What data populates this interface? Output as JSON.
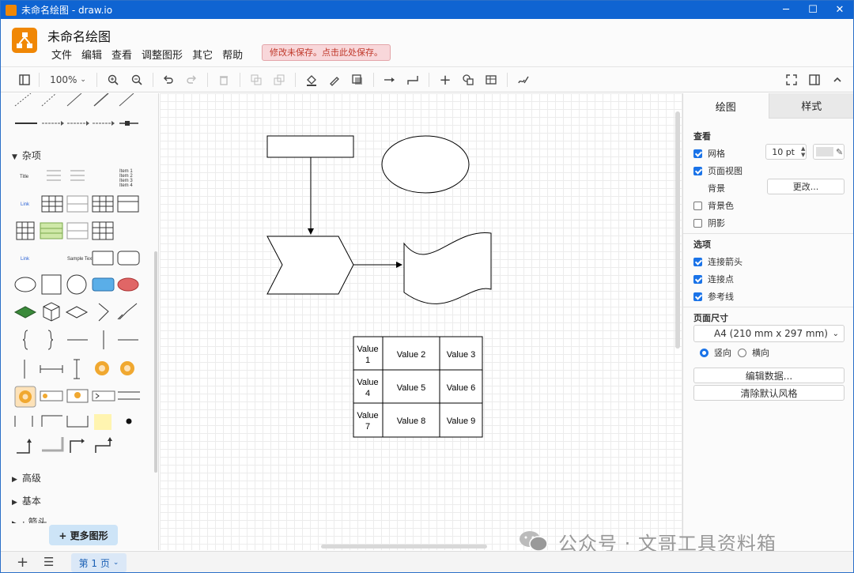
{
  "window": {
    "title": "未命名绘图 - draw.io",
    "controls": [
      "─",
      "☐",
      "✕"
    ]
  },
  "header": {
    "doc_title": "未命名绘图",
    "unsaved_notice": "修改未保存。点击此处保存。"
  },
  "menu": [
    "文件",
    "编辑",
    "查看",
    "调整图形",
    "其它",
    "帮助"
  ],
  "toolbar": {
    "zoom": "100%"
  },
  "sidebar": {
    "section_misc": "杂项",
    "section_advanced": "高级",
    "section_basic": "基本",
    "section_cut": "· 箭头",
    "more_shapes": "+ 更多图形",
    "misc_title": "Title",
    "misc_link": "Link",
    "misc_items": [
      "Item 1",
      "Item 2",
      "Item 3",
      "Item 4"
    ],
    "misc_sample": "Sample Text"
  },
  "canvas": {
    "table": [
      [
        "Value 1",
        "Value 2",
        "Value 3"
      ],
      [
        "Value 4",
        "Value 5",
        "Value 6"
      ],
      [
        "Value 7",
        "Value 8",
        "Value 9"
      ]
    ]
  },
  "panel": {
    "tab_diagram": "绘图",
    "tab_style": "样式",
    "view_heading": "查看",
    "grid_label": "网格",
    "grid_size": "10 pt",
    "page_view": "页面视图",
    "background_label": "背景",
    "change_button": "更改...",
    "bg_color": "背景色",
    "shadow": "阴影",
    "options_heading": "选项",
    "connection_arrows": "连接箭头",
    "connection_points": "连接点",
    "guides": "参考线",
    "page_size_heading": "页面尺寸",
    "page_size": "A4 (210 mm x 297 mm)",
    "portrait": "竖向",
    "landscape": "横向",
    "edit_data": "编辑数据...",
    "clear_style": "清除默认风格"
  },
  "status": {
    "page_tab": "第 1 页"
  },
  "watermark": "公众号 · 文哥工具资料箱"
}
